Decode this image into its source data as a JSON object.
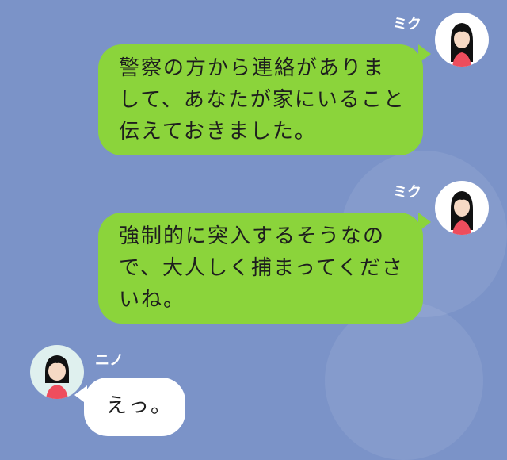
{
  "chat": {
    "messages": [
      {
        "sender": "ミク",
        "text": "警察の方から連絡がありまして、あなたが家にいること伝えておきました。"
      },
      {
        "sender": "ミク",
        "text": "強制的に突入するそうなので、大人しく捕まってくださいね。"
      },
      {
        "sender": "ニノ",
        "text": "えっ。"
      }
    ]
  },
  "colors": {
    "background": "#7b93c8",
    "outgoing_bubble": "#8bd43b",
    "incoming_bubble": "#ffffff"
  },
  "icons": [
    "avatar-miku",
    "avatar-nino"
  ]
}
